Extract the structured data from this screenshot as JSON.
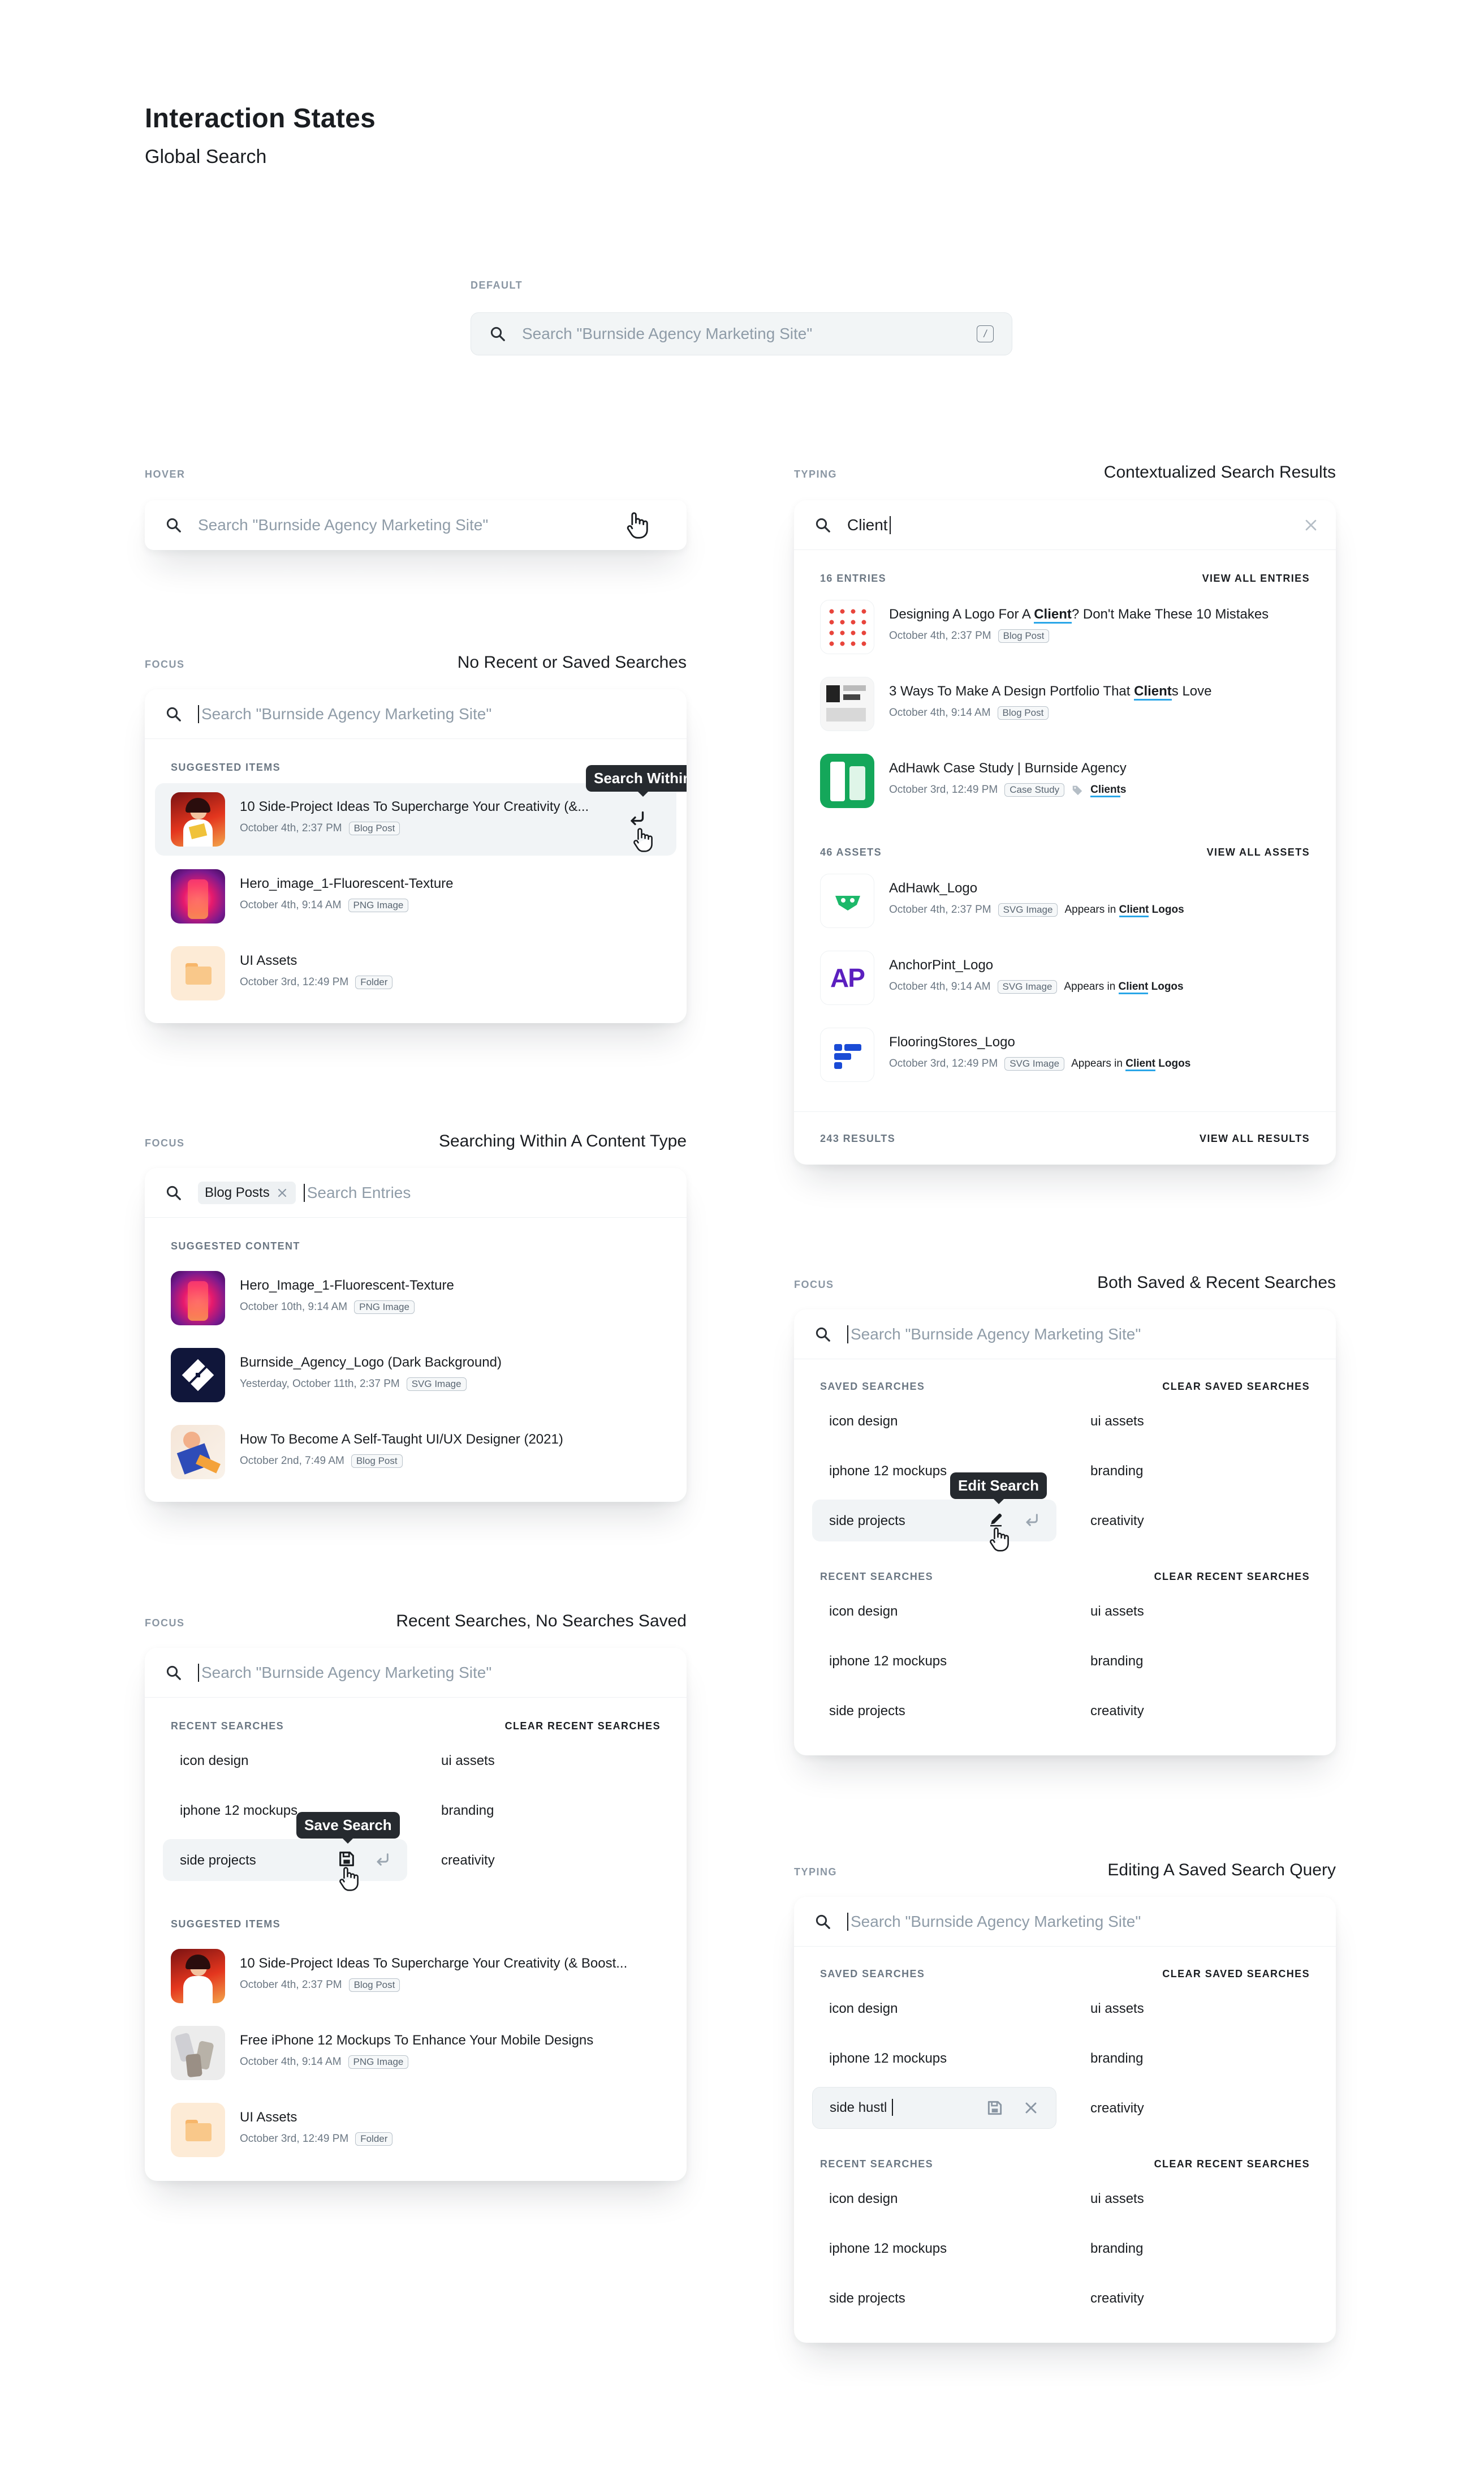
{
  "header": {
    "title": "Interaction States",
    "subtitle": "Global Search"
  },
  "placeholder": "Search \"Burnside Agency Marketing Site\"",
  "default": {
    "label": "DEFAULT",
    "shortcut": "/"
  },
  "hover": {
    "label": "HOVER"
  },
  "focus_empty": {
    "label": "FOCUS",
    "title": "No Recent or Saved Searches",
    "section": "SUGGESTED ITEMS",
    "tooltip": "Search Within",
    "items": [
      {
        "title": "10 Side-Project Ideas To Supercharge Your Creativity (&...",
        "date": "October 4th, 2:37 PM",
        "tag": "Blog Post"
      },
      {
        "title": "Hero_image_1-Fluorescent-Texture",
        "date": "October 4th, 9:14 AM",
        "tag": "PNG Image"
      },
      {
        "title": "UI Assets",
        "date": "October 3rd, 12:49 PM",
        "tag": "Folder"
      }
    ]
  },
  "focus_within": {
    "label": "FOCUS",
    "title": "Searching Within A Content Type",
    "chip": "Blog Posts",
    "placeholder": "Search Entries",
    "section": "SUGGESTED CONTENT",
    "items": [
      {
        "title": "Hero_Image_1-Fluorescent-Texture",
        "date": "October 10th, 9:14 AM",
        "tag": "PNG Image"
      },
      {
        "title": "Burnside_Agency_Logo (Dark Background)",
        "date": "Yesterday, October 11th, 2:37 PM",
        "tag": "SVG Image"
      },
      {
        "title": "How To Become A Self-Taught UI/UX Designer (2021)",
        "date": "October 2nd, 7:49 AM",
        "tag": "Blog Post"
      }
    ]
  },
  "focus_recent": {
    "label": "FOCUS",
    "title": "Recent Searches, No Searches Saved",
    "recent_section": "RECENT SEARCHES",
    "clear_recent": "CLEAR RECENT SEARCHES",
    "left": [
      "icon design",
      "iphone 12 mockups",
      "side projects"
    ],
    "right": [
      "ui assets",
      "branding",
      "creativity"
    ],
    "tooltip": "Save Search",
    "suggested_section": "SUGGESTED ITEMS",
    "items": [
      {
        "title": "10 Side-Project Ideas To Supercharge Your Creativity (& Boost...",
        "date": "October 4th, 2:37 PM",
        "tag": "Blog Post"
      },
      {
        "title": "Free iPhone 12 Mockups To Enhance Your Mobile Designs",
        "date": "October 4th, 9:14 AM",
        "tag": "PNG Image"
      },
      {
        "title": "UI Assets",
        "date": "October 3rd, 12:49 PM",
        "tag": "Folder"
      }
    ]
  },
  "typing": {
    "label": "TYPING",
    "title": "Contextualized Search Results",
    "query": "Client",
    "entries_count": "16 ENTRIES",
    "view_entries": "VIEW ALL ENTRIES",
    "entries": [
      {
        "pre": "Designing A Logo For A ",
        "hl": "Client",
        "post": "? Don't Make These 10 Mistakes",
        "date": "October 4th, 2:37 PM",
        "tag": "Blog Post"
      },
      {
        "pre": "3 Ways To Make A Design Portfolio That ",
        "hl": "Client",
        "post": "s Love",
        "date": "October 4th, 9:14 AM",
        "tag": "Blog Post"
      },
      {
        "pre": "AdHawk Case Study | Burnside Agency",
        "hl": "",
        "post": "",
        "date": "October 3rd, 12:49 PM",
        "tag": "Case Study",
        "extra_hl": "Client",
        "extra_post": "s"
      }
    ],
    "assets_count": "46 ASSETS",
    "view_assets": "VIEW ALL ASSETS",
    "assets": [
      {
        "title": "AdHawk_Logo",
        "date": "October 4th, 2:37 PM",
        "tag": "SVG Image",
        "appears": "Appears in",
        "hl": "Client",
        "post": " Logos"
      },
      {
        "title": "AnchorPint_Logo",
        "date": "October 4th, 9:14 AM",
        "tag": "SVG Image",
        "appears": "Appears in",
        "hl": "Client",
        "post": " Logos"
      },
      {
        "title": "FlooringStores_Logo",
        "date": "October 3rd, 12:49 PM",
        "tag": "SVG Image",
        "appears": "Appears in",
        "hl": "Client",
        "post": " Logos"
      }
    ],
    "ap_mark": "AP",
    "results_count": "243 RESULTS",
    "view_results": "VIEW ALL RESULTS"
  },
  "focus_both": {
    "label": "FOCUS",
    "title": "Both Saved & Recent Searches",
    "saved_section": "SAVED SEARCHES",
    "clear_saved": "CLEAR SAVED SEARCHES",
    "recent_section": "RECENT SEARCHES",
    "clear_recent": "CLEAR RECENT SEARCHES",
    "left": [
      "icon design",
      "iphone 12 mockups",
      "side projects"
    ],
    "right": [
      "ui assets",
      "branding",
      "creativity"
    ],
    "tooltip": "Edit Search"
  },
  "editing": {
    "label": "TYPING",
    "title": "Editing A Saved Search Query",
    "saved_section": "SAVED SEARCHES",
    "clear_saved": "CLEAR SAVED SEARCHES",
    "recent_section": "RECENT SEARCHES",
    "clear_recent": "CLEAR RECENT SEARCHES",
    "left": [
      "icon design",
      "iphone 12 mockups"
    ],
    "editing_value": "side hustl",
    "right": [
      "ui assets",
      "branding",
      "creativity"
    ],
    "recent_left": [
      "icon design",
      "iphone 12 mockups",
      "side projects"
    ],
    "recent_right": [
      "ui assets",
      "branding",
      "creativity"
    ]
  }
}
